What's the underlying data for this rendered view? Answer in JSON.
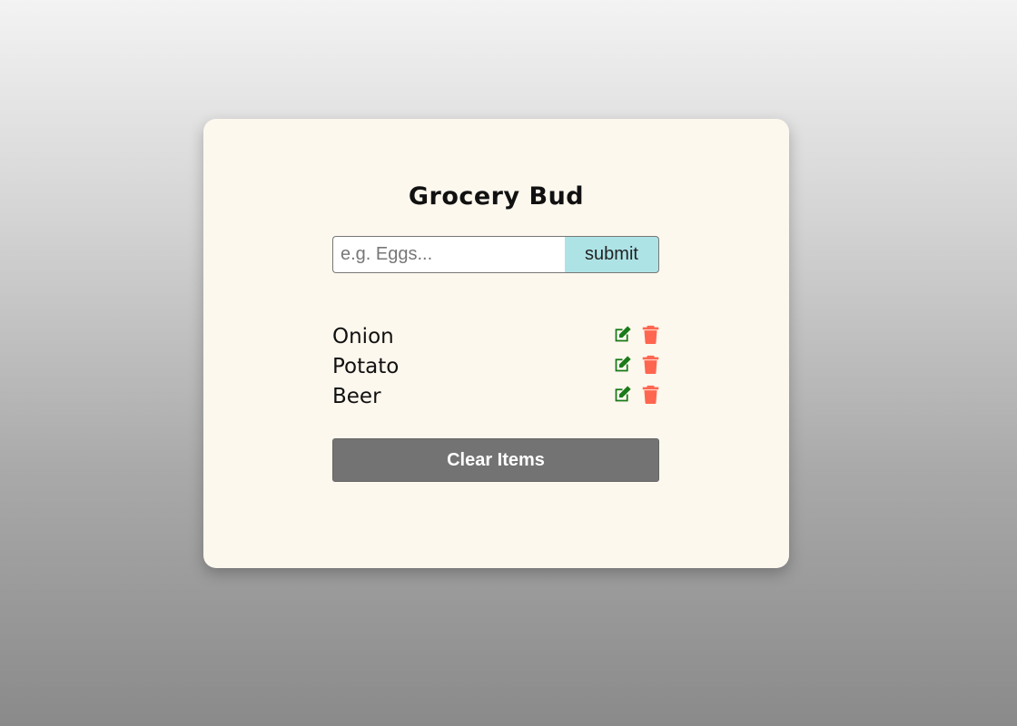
{
  "app": {
    "title": "Grocery Bud"
  },
  "form": {
    "input_value": "",
    "input_placeholder": "e.g. Eggs...",
    "submit_label": "submit"
  },
  "items": [
    {
      "name": "Onion",
      "edit_icon": "edit-icon",
      "delete_icon": "trash-icon"
    },
    {
      "name": "Potato",
      "edit_icon": "edit-icon",
      "delete_icon": "trash-icon"
    },
    {
      "name": "Beer",
      "edit_icon": "edit-icon",
      "delete_icon": "trash-icon"
    }
  ],
  "clear_button": {
    "label": "Clear Items"
  },
  "colors": {
    "card_background": "#fdf8ee",
    "submit_background": "#aee3e6",
    "edit_icon": "#1a7a1a",
    "delete_icon": "#ff6650",
    "clear_button_background": "#737373"
  }
}
